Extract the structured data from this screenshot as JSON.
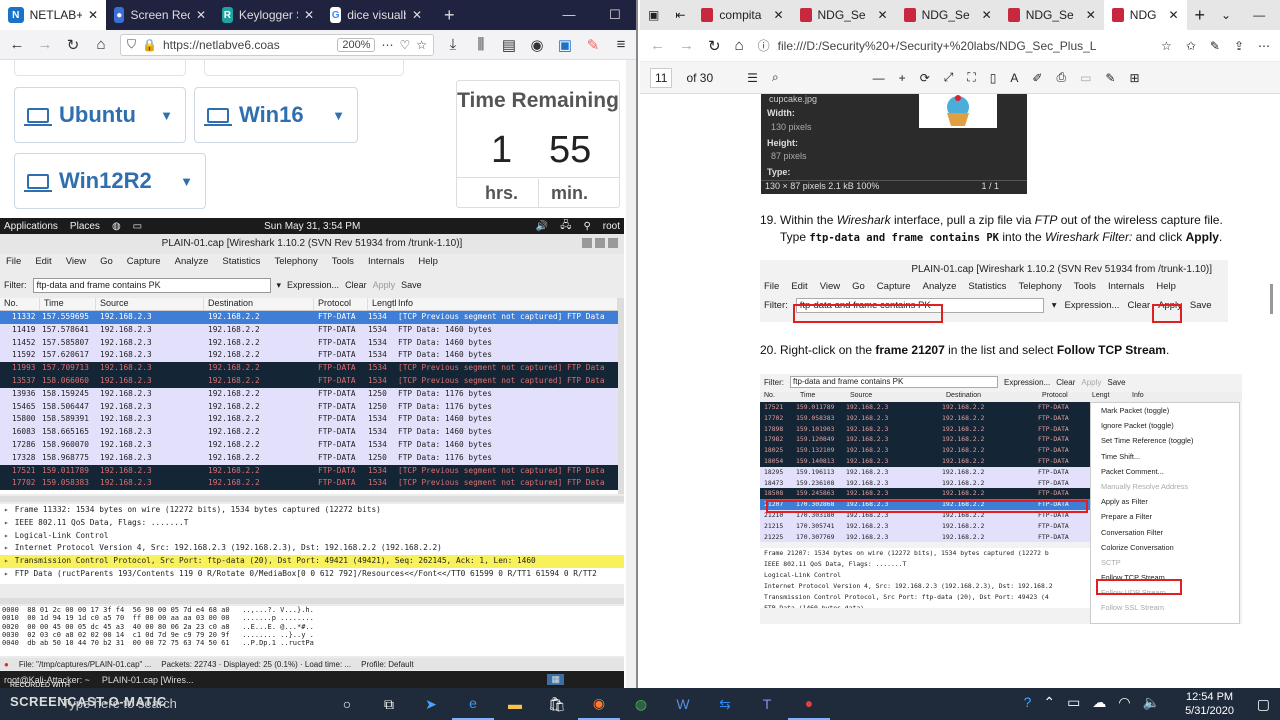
{
  "left_browser": {
    "tabs": [
      {
        "label": "NETLAB+",
        "active": true,
        "fav": "N",
        "color": "#1a73c9"
      },
      {
        "label": "Screen Recorder",
        "active": false,
        "fav": "●",
        "color": "#3a6fd8"
      },
      {
        "label": "Keylogger Softw",
        "active": false,
        "fav": "R",
        "color": "#1fa3a3"
      },
      {
        "label": "dice visualbasic",
        "active": false,
        "fav": "G",
        "color": "#fff"
      }
    ],
    "url": "https://netlabve6.coas",
    "zoom": "200%"
  },
  "netlab": {
    "vms": [
      "Ubuntu",
      "Win16",
      "Win12R2"
    ],
    "time_title": "Time Remaining",
    "hours": "1",
    "minutes": "55",
    "hours_label": "hrs.",
    "minutes_label": "min."
  },
  "kali_bar": {
    "applications": "Applications",
    "places": "Places",
    "datetime": "Sun May 31,  3:54 PM",
    "user": "root"
  },
  "wireshark": {
    "title": "PLAIN-01.cap  [Wireshark 1.10.2  (SVN Rev 51934 from /trunk-1.10)]",
    "menu": [
      "File",
      "Edit",
      "View",
      "Go",
      "Capture",
      "Analyze",
      "Statistics",
      "Telephony",
      "Tools",
      "Internals",
      "Help"
    ],
    "filter_label": "Filter:",
    "filter_value": "ftp-data and frame contains PK",
    "filter_buttons": [
      "Expression...",
      "Clear",
      "Apply",
      "Save"
    ],
    "columns": [
      "No.",
      "Time",
      "Source",
      "Destination",
      "Protocol",
      "Lengtl",
      "Info"
    ],
    "rows": [
      {
        "style": "rsel",
        "no": "11332",
        "time": "157.559695",
        "src": "192.168.2.3",
        "dst": "192.168.2.2",
        "proto": "FTP-DATA",
        "len": "1534",
        "info": "[TCP Previous segment not captured] FTP Data"
      },
      {
        "style": "rlav",
        "no": "11419",
        "time": "157.578641",
        "src": "192.168.2.3",
        "dst": "192.168.2.2",
        "proto": "FTP-DATA",
        "len": "1534",
        "info": "FTP Data: 1460 bytes"
      },
      {
        "style": "rlav",
        "no": "11452",
        "time": "157.585807",
        "src": "192.168.2.3",
        "dst": "192.168.2.2",
        "proto": "FTP-DATA",
        "len": "1534",
        "info": "FTP Data: 1460 bytes"
      },
      {
        "style": "rlav",
        "no": "11592",
        "time": "157.620617",
        "src": "192.168.2.3",
        "dst": "192.168.2.2",
        "proto": "FTP-DATA",
        "len": "1534",
        "info": "FTP Data: 1460 bytes"
      },
      {
        "style": "rdark",
        "no": "11993",
        "time": "157.709713",
        "src": "192.168.2.3",
        "dst": "192.168.2.2",
        "proto": "FTP-DATA",
        "len": "1534",
        "info": "[TCP Previous segment not captured] FTP Data"
      },
      {
        "style": "rdark",
        "no": "13537",
        "time": "158.066060",
        "src": "192.168.2.3",
        "dst": "192.168.2.2",
        "proto": "FTP-DATA",
        "len": "1534",
        "info": "[TCP Previous segment not captured] FTP Data"
      },
      {
        "style": "rlav",
        "no": "13936",
        "time": "158.159245",
        "src": "192.168.2.3",
        "dst": "192.168.2.2",
        "proto": "FTP-DATA",
        "len": "1250",
        "info": "FTP Data: 1176 bytes"
      },
      {
        "style": "rlav",
        "no": "15465",
        "time": "158.506447",
        "src": "192.168.2.3",
        "dst": "192.168.2.2",
        "proto": "FTP-DATA",
        "len": "1250",
        "info": "FTP Data: 1176 bytes"
      },
      {
        "style": "rlav",
        "no": "15800",
        "time": "158.589391",
        "src": "192.168.2.3",
        "dst": "192.168.2.2",
        "proto": "FTP-DATA",
        "len": "1534",
        "info": "FTP Data: 1460 bytes"
      },
      {
        "style": "rlav",
        "no": "16083",
        "time": "158.665165",
        "src": "192.168.2.3",
        "dst": "192.168.2.2",
        "proto": "FTP-DATA",
        "len": "1534",
        "info": "FTP Data: 1460 bytes"
      },
      {
        "style": "rlav",
        "no": "17286",
        "time": "158.960070",
        "src": "192.168.2.3",
        "dst": "192.168.2.2",
        "proto": "FTP-DATA",
        "len": "1534",
        "info": "FTP Data: 1460 bytes"
      },
      {
        "style": "rlav",
        "no": "17328",
        "time": "158.968775",
        "src": "192.168.2.3",
        "dst": "192.168.2.2",
        "proto": "FTP-DATA",
        "len": "1250",
        "info": "FTP Data: 1176 bytes"
      },
      {
        "style": "rdark",
        "no": "17521",
        "time": "159.011789",
        "src": "192.168.2.3",
        "dst": "192.168.2.2",
        "proto": "FTP-DATA",
        "len": "1534",
        "info": "[TCP Previous segment not captured] FTP Data"
      },
      {
        "style": "rdark",
        "no": "17702",
        "time": "159.058383",
        "src": "192.168.2.3",
        "dst": "192.168.2.2",
        "proto": "FTP-DATA",
        "len": "1534",
        "info": "[TCP Previous segment not captured] FTP Data"
      }
    ],
    "details": [
      {
        "text": "Frame 11332: 1534 bytes on wire (12272 bits), 1534 bytes captured (12272 bits)",
        "hl": false
      },
      {
        "text": "IEEE 802.11 QoS Data, Flags: .......T",
        "hl": false
      },
      {
        "text": "Logical-Link Control",
        "hl": false
      },
      {
        "text": "Internet Protocol Version 4, Src: 192.168.2.3 (192.168.2.3), Dst: 192.168.2.2 (192.168.2.2)",
        "hl": false
      },
      {
        "text": "Transmission Control Protocol, Src Port: ftp-data (20), Dst Port: 49421 (49421), Seq: 262145, Ack: 1, Len: 1460",
        "hl": true
      },
      {
        "text": "FTP Data (ructParents 193/Contents 119 0 R/Rotate 0/MediaBox[0 0 612 792]/Resources<</Font<</TT0 61599 0 R/TT1 61594 0 R/TT2",
        "hl": false
      }
    ],
    "hex": [
      "0000  88 01 2c 00 00 17 3f f4  56 90 00 05 7d e4 68 a0   ..,...?. V...}.h.",
      "0010  00 1d 94 19 1d c0 a5 70  ff 00 00 aa aa 03 00 00   .......p ........",
      "0020  00 00 45 00 05 dc 45 a3  40 00 80 06 2a 23 c0 a8   ..E...E. @...*#..",
      "0030  02 03 c0 a8 02 02 00 14  c1 0d 7d 9e c9 79 20 9f   ........ ..}..y .",
      "0040  db ab 50 10 44 70 b2 31  00 00 72 75 63 74 50 61   ..P.Dp.1 ..ructPa"
    ],
    "status": {
      "file": "File: \"/tmp/captures/PLAIN-01.cap\" ...",
      "packets": "Packets: 22743 · Displayed: 25 (0.1%) · Load time: ...",
      "profile": "Profile: Default"
    },
    "kali_task": [
      "root@Kali-Attacker: ~",
      "PLAIN-01.cap  [Wires..."
    ]
  },
  "right_browser": {
    "tabs": [
      "compita",
      "NDG_Se",
      "NDG_Se",
      "NDG_Se",
      "NDG"
    ],
    "url": "file:///D:/Security%20+/Security+%20labs/NDG_Sec_Plus_L",
    "page": "11",
    "of_pages": "of 30"
  },
  "pdf": {
    "image_info": {
      "file": "cupcake.jpg",
      "width_label": "Width:",
      "width": "130 pixels",
      "height_label": "Height:",
      "height": "87 pixels",
      "type_label": "Type:",
      "footer": "130 × 87 pixels  2.1 kB   100%",
      "pager": "1 / 1"
    },
    "step19_prefix": "19. Within the ",
    "step19_italic1": "Wireshark",
    "step19_mid": " interface, pull a zip file via ",
    "step19_italic2": "FTP",
    "step19_end": " out of the wireless capture file.",
    "step19_line2_a": "Type ",
    "step19_code": "ftp-data and frame contains PK",
    "step19_line2_b": " into the ",
    "step19_italic3": "Wireshark Filter:",
    "step19_line2_c": " and click ",
    "step19_apply": "Apply",
    "step19_dot": ".",
    "fig1": {
      "title": "PLAIN-01.cap  [Wireshark 1.10.2  (SVN Rev 51934 from /trunk-1.10)]",
      "menu": [
        "File",
        "Edit",
        "View",
        "Go",
        "Capture",
        "Analyze",
        "Statistics",
        "Telephony",
        "Tools",
        "Internals",
        "Help"
      ],
      "filter_label": "Filter:",
      "filter_value": "ftp-data and frame contains PK",
      "buttons": [
        "Expression...",
        "Clear",
        "Apply",
        "Save"
      ]
    },
    "step20_a": "20. Right-click on the ",
    "step20_b": "frame 21207",
    "step20_c": " in the list and select ",
    "step20_d": "Follow TCP Stream",
    "step20_e": ".",
    "fig2": {
      "filter_label": "Filter:",
      "filter_value": "ftp-data and frame contains PK",
      "buttons": [
        "Expression...",
        "Clear",
        "Apply",
        "Save"
      ],
      "columns": [
        "No.",
        "Time",
        "Source",
        "Destination",
        "Protocol",
        "Lengt",
        "Info"
      ],
      "rows": [
        {
          "style": "d",
          "no": "17521",
          "time": "159.011789",
          "src": "192.168.2.3",
          "dst": "192.168.2.2",
          "proto": "FTP-DATA"
        },
        {
          "style": "d",
          "no": "17702",
          "time": "159.058383",
          "src": "192.168.2.3",
          "dst": "192.168.2.2",
          "proto": "FTP-DATA"
        },
        {
          "style": "d",
          "no": "17898",
          "time": "159.101903",
          "src": "192.168.2.3",
          "dst": "192.168.2.2",
          "proto": "FTP-DATA"
        },
        {
          "style": "d",
          "no": "17982",
          "time": "159.120849",
          "src": "192.168.2.3",
          "dst": "192.168.2.2",
          "proto": "FTP-DATA"
        },
        {
          "style": "d",
          "no": "18025",
          "time": "159.132109",
          "src": "192.168.2.3",
          "dst": "192.168.2.2",
          "proto": "FTP-DATA"
        },
        {
          "style": "d",
          "no": "18054",
          "time": "159.140813",
          "src": "192.168.2.3",
          "dst": "192.168.2.2",
          "proto": "FTP-DATA"
        },
        {
          "style": "l",
          "no": "18295",
          "time": "159.196113",
          "src": "192.168.2.3",
          "dst": "192.168.2.2",
          "proto": "FTP-DATA"
        },
        {
          "style": "l",
          "no": "18473",
          "time": "159.236108",
          "src": "192.168.2.3",
          "dst": "192.168.2.2",
          "proto": "FTP-DATA"
        },
        {
          "style": "d",
          "no": "18508",
          "time": "159.245863",
          "src": "192.168.2.3",
          "dst": "192.168.2.2",
          "proto": "FTP-DATA"
        },
        {
          "style": "s",
          "no": "21207",
          "time": "170.302868",
          "src": "192.168.2.3",
          "dst": "192.168.2.2",
          "proto": "FTP-DATA"
        },
        {
          "style": "l",
          "no": "21210",
          "time": "170.303180",
          "src": "192.168.2.3",
          "dst": "192.168.2.2",
          "proto": "FTP-DATA"
        },
        {
          "style": "l",
          "no": "21215",
          "time": "170.305741",
          "src": "192.168.2.3",
          "dst": "192.168.2.2",
          "proto": "FTP-DATA"
        },
        {
          "style": "l",
          "no": "21225",
          "time": "170.307769",
          "src": "192.168.2.3",
          "dst": "192.168.2.2",
          "proto": "FTP-DATA"
        }
      ],
      "details": [
        "Frame 21207: 1534 bytes on wire (12272 bits), 1534 bytes captured (12272 b",
        "IEEE 802.11 QoS Data, Flags: .......T",
        "Logical-Link Control",
        "Internet Protocol Version 4, Src: 192.168.2.3 (192.168.2.3), Dst: 192.168.2",
        "Transmission Control Protocol, Src Port: ftp-data (20), Dst Port: 49423 (4",
        "FTP Data (1460 bytes data)"
      ],
      "context_menu": [
        {
          "label": "Mark Packet (toggle)",
          "dis": false
        },
        {
          "label": "Ignore Packet (toggle)",
          "dis": false
        },
        {
          "label": "Set Time Reference (toggle)",
          "dis": false
        },
        {
          "label": "Time Shift...",
          "dis": false
        },
        {
          "label": "Packet Comment...",
          "dis": false
        },
        {
          "label": "Manually Resolve Address",
          "dis": true
        },
        {
          "label": "Apply as Filter",
          "dis": false
        },
        {
          "label": "Prepare a Filter",
          "dis": false
        },
        {
          "label": "Conversation Filter",
          "dis": false
        },
        {
          "label": "Colorize Conversation",
          "dis": false
        },
        {
          "label": "SCTP",
          "dis": true
        },
        {
          "label": "Follow TCP Stream",
          "dis": false
        },
        {
          "label": "Follow UDP Stream",
          "dis": true
        },
        {
          "label": "Follow SSL Stream",
          "dis": true
        }
      ]
    }
  },
  "taskbar": {
    "watermark_top": "RECORDED WITH",
    "watermark_brand": "SCREENCAST-O-MATIC",
    "search": "Type here to search",
    "time": "12:54 PM",
    "date": "5/31/2020"
  }
}
